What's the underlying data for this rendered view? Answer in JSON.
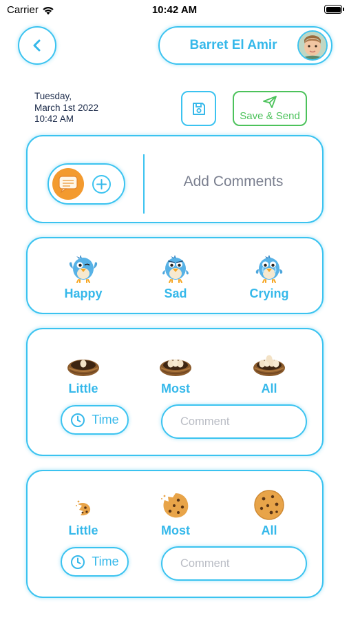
{
  "status_bar": {
    "carrier": "Carrier",
    "time": "10:42 AM"
  },
  "header": {
    "child_name": "Barret El Amir"
  },
  "date_block": {
    "day": "Tuesday,",
    "date": "March 1st 2022",
    "time": "10:42 AM"
  },
  "actions": {
    "save_send_label": "Save & Send"
  },
  "comments_card": {
    "label": "Add Comments"
  },
  "mood": {
    "options": [
      {
        "label": "Happy"
      },
      {
        "label": "Sad"
      },
      {
        "label": "Crying"
      }
    ]
  },
  "eggs_meal": {
    "options": [
      {
        "label": "Little"
      },
      {
        "label": "Most"
      },
      {
        "label": "All"
      }
    ],
    "time_label": "Time",
    "comment_placeholder": "Comment"
  },
  "cookies_meal": {
    "options": [
      {
        "label": "Little"
      },
      {
        "label": "Most"
      },
      {
        "label": "All"
      }
    ],
    "time_label": "Time",
    "comment_placeholder": "Comment"
  },
  "colors": {
    "accent": "#3bc3f0",
    "accent_text": "#35b8ea",
    "send_green": "#4cc25b",
    "chat_orange": "#f39a2f"
  }
}
